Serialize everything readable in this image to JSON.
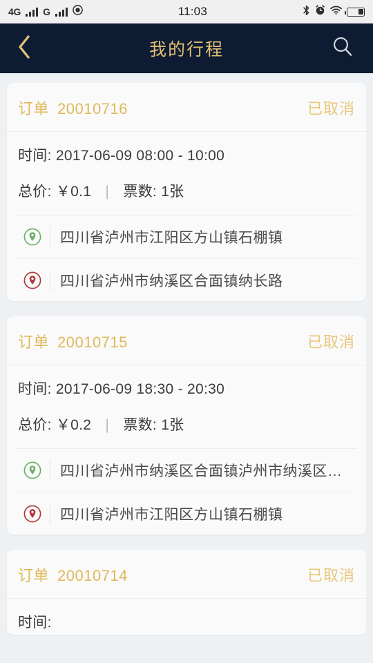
{
  "statusbar": {
    "network_primary": "4G",
    "network_secondary": "G",
    "time": "11:03",
    "icons": {
      "signal_primary": "signal-bars-icon",
      "signal_secondary": "signal-bars-icon",
      "location": "location-circle-icon",
      "bluetooth": "bluetooth-icon",
      "alarm": "alarm-clock-icon",
      "wifi": "wifi-icon",
      "battery": "battery-icon"
    }
  },
  "navbar": {
    "title": "我的行程",
    "back_icon": "chevron-left-icon",
    "search_icon": "search-icon",
    "background": "#0d1b33",
    "accent": "#e3bf72"
  },
  "colors": {
    "page_background": "#eef1f4",
    "card_background": "#fafafa",
    "order_gold": "#e0b858",
    "status_gold": "#e8c77a",
    "origin_green": "#6ab06a",
    "destination_red": "#b03a3a"
  },
  "orders": [
    {
      "order_label": "订单",
      "order_number": "20010716",
      "status": "已取消",
      "time_label": "时间:",
      "time_value": "2017-06-09 08:00 - 10:00",
      "price_label": "总价:",
      "price_value": "￥0.1",
      "separator": "|",
      "tickets_label": "票数:",
      "tickets_value": "1张",
      "origin": "四川省泸州市江阳区方山镇石棚镇",
      "destination": "四川省泸州市纳溪区合面镇纳长路"
    },
    {
      "order_label": "订单",
      "order_number": "20010715",
      "status": "已取消",
      "time_label": "时间:",
      "time_value": "2017-06-09 18:30 - 20:30",
      "price_label": "总价:",
      "price_value": "￥0.2",
      "separator": "|",
      "tickets_label": "票数:",
      "tickets_value": "1张",
      "origin": "四川省泸州市纳溪区合面镇泸州市纳溪区合面镇",
      "destination": "四川省泸州市江阳区方山镇石棚镇"
    },
    {
      "order_label": "订单",
      "order_number": "20010714",
      "status": "已取消",
      "time_label": "时间:",
      "time_value": "",
      "price_label": "",
      "price_value": "",
      "separator": "",
      "tickets_label": "",
      "tickets_value": "",
      "origin": "",
      "destination": ""
    }
  ]
}
